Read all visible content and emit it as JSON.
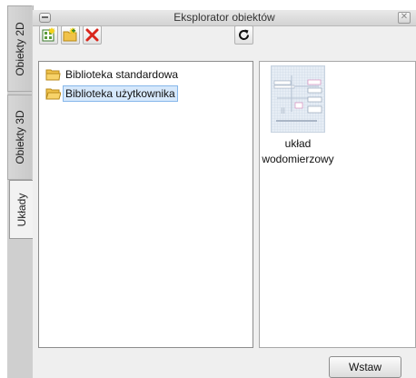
{
  "window": {
    "title": "Eksplorator obiektów",
    "close_glyph": "✕"
  },
  "side_tabs": [
    {
      "label": "Obiekty 2D",
      "active": false
    },
    {
      "label": "Obiekty 3D",
      "active": false
    },
    {
      "label": "Układy",
      "active": true
    }
  ],
  "toolbar": {
    "buttons": [
      {
        "name": "new-object",
        "icon": "new-object-icon"
      },
      {
        "name": "new-folder",
        "icon": "new-folder-icon"
      },
      {
        "name": "delete",
        "icon": "delete-x-icon",
        "color": "#d9261c"
      },
      {
        "name": "refresh",
        "icon": "refresh-icon"
      }
    ]
  },
  "tree": {
    "items": [
      {
        "label": "Biblioteka standardowa",
        "selected": false
      },
      {
        "label": "Biblioteka użytkownika",
        "selected": true
      }
    ]
  },
  "preview": {
    "items": [
      {
        "label_line1": "układ",
        "label_line2": "wodomierzowy"
      }
    ]
  },
  "footer": {
    "insert_label": "Wstaw"
  },
  "colors": {
    "selection_bg": "#d6e8fb",
    "selection_border": "#86b7ea",
    "folder_yellow": "#f0c24a"
  }
}
